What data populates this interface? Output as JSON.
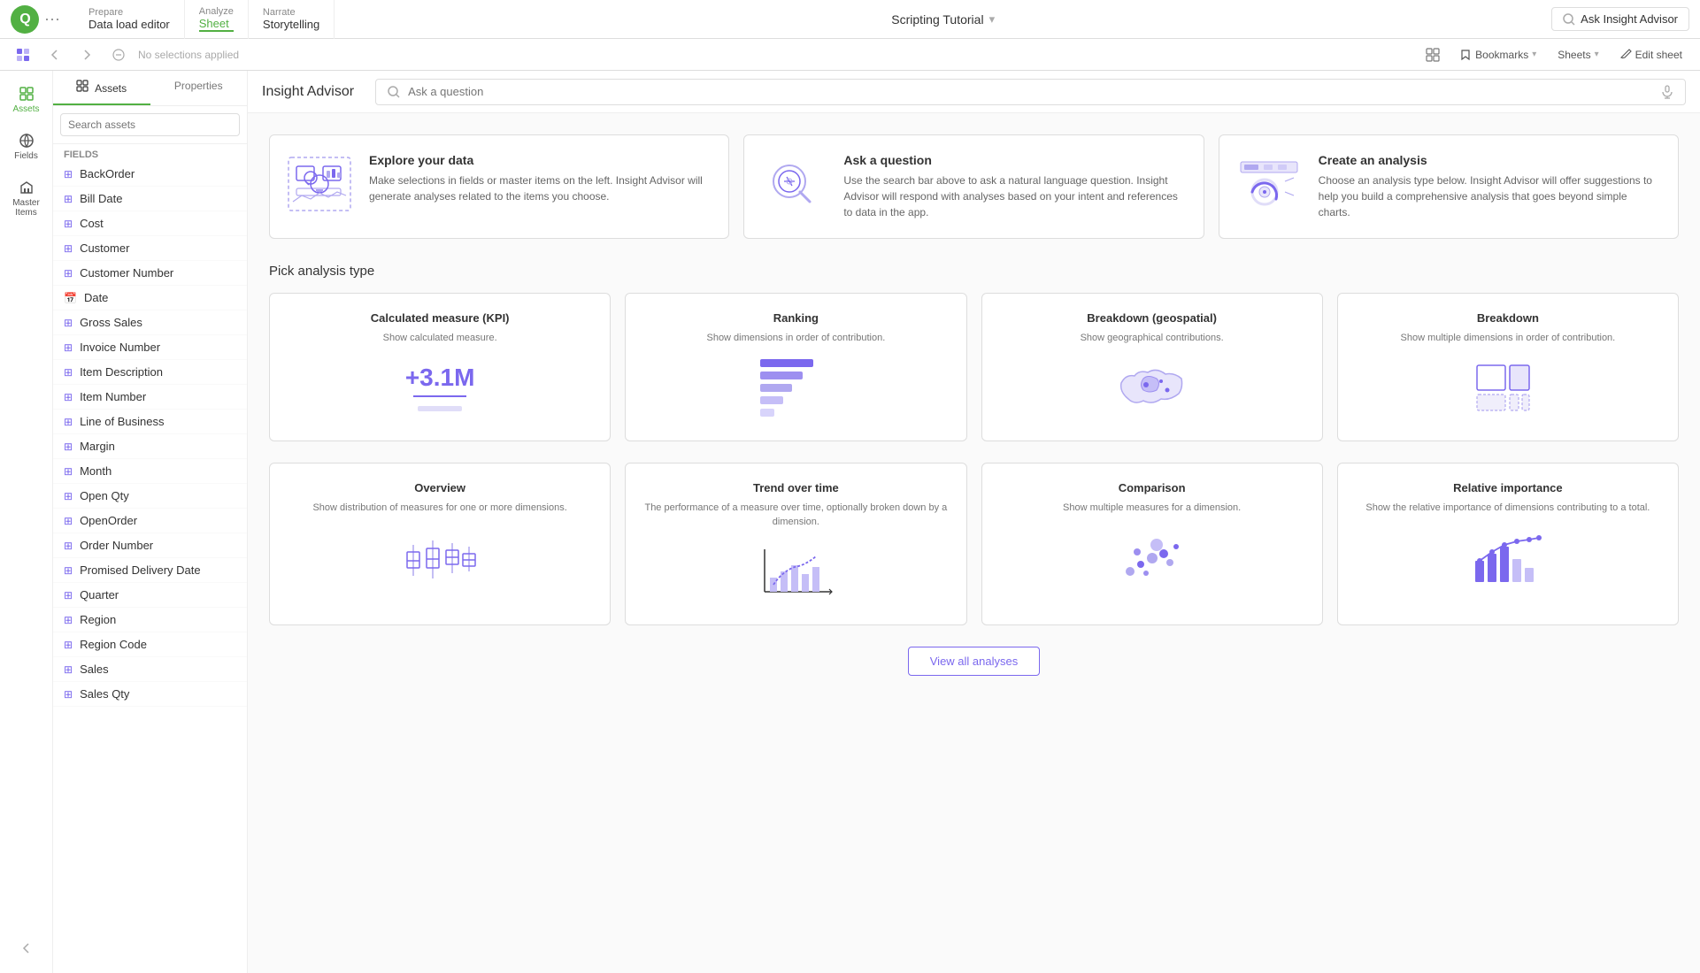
{
  "topNav": {
    "logo": "Q",
    "dotsLabel": "...",
    "prepare": {
      "label": "Prepare",
      "value": "Data load editor"
    },
    "analyze": {
      "label": "Analyze",
      "value": "Sheet",
      "active": true
    },
    "narrate": {
      "label": "Narrate",
      "value": "Storytelling"
    },
    "appTitle": "Scripting Tutorial",
    "askInsight": "Ask Insight Advisor"
  },
  "secondToolbar": {
    "noSelections": "No selections applied",
    "bookmarks": "Bookmarks",
    "sheets": "Sheets",
    "editSheet": "Edit sheet"
  },
  "leftSidebar": {
    "items": [
      {
        "name": "assets",
        "label": "Assets"
      },
      {
        "name": "fields",
        "label": "Fields"
      },
      {
        "name": "masterItems",
        "label": "Master Items"
      }
    ]
  },
  "assetPanel": {
    "tabs": [
      "Assets",
      "Properties"
    ],
    "searchPlaceholder": "Search assets",
    "groups": {
      "fields": {
        "label": "Fields",
        "items": [
          {
            "name": "BackOrder",
            "icon": "field"
          },
          {
            "name": "Bill Date",
            "icon": "field"
          },
          {
            "name": "Cost",
            "icon": "field"
          },
          {
            "name": "Customer",
            "icon": "field"
          },
          {
            "name": "Customer Number",
            "icon": "field"
          },
          {
            "name": "Date",
            "icon": "calendar"
          },
          {
            "name": "Gross Sales",
            "icon": "field"
          },
          {
            "name": "Invoice Number",
            "icon": "field"
          },
          {
            "name": "Item Description",
            "icon": "field"
          },
          {
            "name": "Item Number",
            "icon": "field"
          },
          {
            "name": "Line of Business",
            "icon": "field"
          },
          {
            "name": "Margin",
            "icon": "field"
          },
          {
            "name": "Month",
            "icon": "field"
          },
          {
            "name": "Open Qty",
            "icon": "field"
          },
          {
            "name": "OpenOrder",
            "icon": "field"
          },
          {
            "name": "Order Number",
            "icon": "field"
          },
          {
            "name": "Promised Delivery Date",
            "icon": "field"
          },
          {
            "name": "Quarter",
            "icon": "field"
          },
          {
            "name": "Region",
            "icon": "field"
          },
          {
            "name": "Region Code",
            "icon": "field"
          },
          {
            "name": "Sales",
            "icon": "field"
          },
          {
            "name": "Sales Qty",
            "icon": "field"
          }
        ]
      }
    }
  },
  "insightAdvisor": {
    "title": "Insight Advisor",
    "searchPlaceholder": "Ask a question"
  },
  "introCards": [
    {
      "title": "Explore your data",
      "description": "Make selections in fields or master items on the left. Insight Advisor will generate analyses related to the items you choose."
    },
    {
      "title": "Ask a question",
      "description": "Use the search bar above to ask a natural language question. Insight Advisor will respond with analyses based on your intent and references to data in the app."
    },
    {
      "title": "Create an analysis",
      "description": "Choose an analysis type below. Insight Advisor will offer suggestions to help you build a comprehensive analysis that goes beyond simple charts."
    }
  ],
  "analysisSection": {
    "title": "Pick analysis type",
    "types": [
      {
        "title": "Calculated measure (KPI)",
        "description": "Show calculated measure.",
        "viz": "kpi"
      },
      {
        "title": "Ranking",
        "description": "Show dimensions in order of contribution.",
        "viz": "ranking"
      },
      {
        "title": "Breakdown (geospatial)",
        "description": "Show geographical contributions.",
        "viz": "map"
      },
      {
        "title": "Breakdown",
        "description": "Show multiple dimensions in order of contribution.",
        "viz": "breakdown"
      },
      {
        "title": "Overview",
        "description": "Show distribution of measures for one or more dimensions.",
        "viz": "boxplot"
      },
      {
        "title": "Trend over time",
        "description": "The performance of a measure over time, optionally broken down by a dimension.",
        "viz": "linechart"
      },
      {
        "title": "Comparison",
        "description": "Show multiple measures for a dimension.",
        "viz": "scatter"
      },
      {
        "title": "Relative importance",
        "description": "Show the relative importance of dimensions contributing to a total.",
        "viz": "bar"
      }
    ],
    "viewAllLabel": "View all analyses",
    "kpiValue": "+3.1M"
  }
}
